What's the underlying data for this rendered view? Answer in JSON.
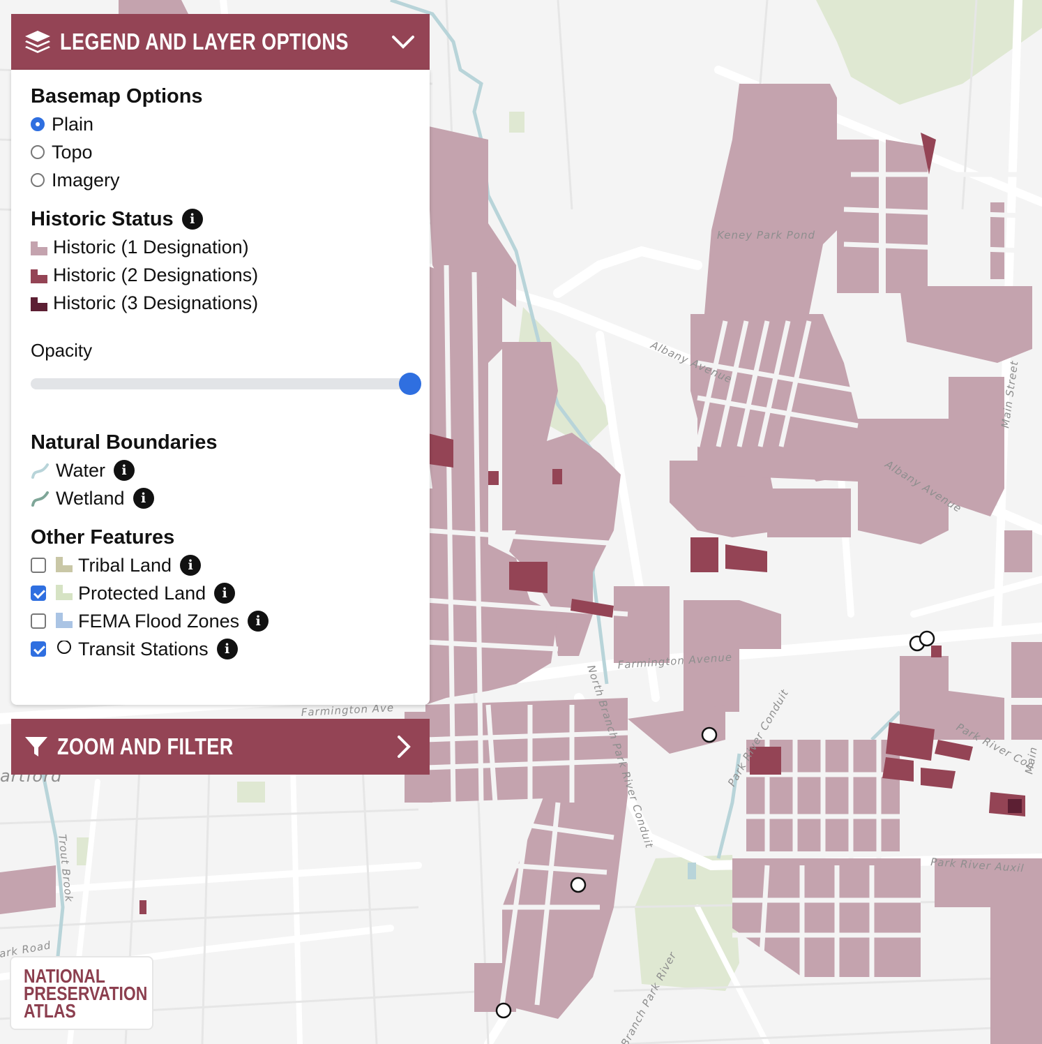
{
  "legend": {
    "header_title": "Legend and Layer Options",
    "basemap": {
      "title": "Basemap Options",
      "options": [
        {
          "label": "Plain",
          "selected": true
        },
        {
          "label": "Topo",
          "selected": false
        },
        {
          "label": "Imagery",
          "selected": false
        }
      ]
    },
    "historic": {
      "title": "Historic Status",
      "items": [
        {
          "label": "Historic (1 Designation)",
          "color": "#c4a3ae"
        },
        {
          "label": "Historic (2 Designations)",
          "color": "#944455"
        },
        {
          "label": "Historic (3 Designations)",
          "color": "#5c1f33"
        }
      ],
      "opacity_label": "Opacity",
      "opacity_value": 1.0
    },
    "natural": {
      "title": "Natural Boundaries",
      "items": [
        {
          "label": "Water",
          "color": "#b8d4d9"
        },
        {
          "label": "Wetland",
          "color": "#7fa698"
        }
      ]
    },
    "other": {
      "title": "Other Features",
      "items": [
        {
          "label": "Tribal Land",
          "checked": false,
          "color": "#c9c7a6"
        },
        {
          "label": "Protected Land",
          "checked": true,
          "color": "#d6e3c4"
        },
        {
          "label": "FEMA Flood Zones",
          "checked": false,
          "color": "#aac4e4"
        },
        {
          "label": "Transit Stations",
          "checked": true,
          "icon": "circle-outline"
        }
      ]
    }
  },
  "zoom_filter": {
    "title": "Zoom and Filter"
  },
  "map_labels": {
    "keney_park_pond": "Keney Park Pond",
    "albany_avenue_1": "Albany Avenue",
    "albany_avenue_2": "Albany Avenue",
    "main_street": "Main Street",
    "farmington_avenue_1": "Farmington Avenue",
    "farmington_avenue_2": "Farmington Ave",
    "north_branch_conduit": "North Branch Park River Conduit",
    "park_river_conduit": "Park River Conduit",
    "park_river_conduit_2": "Park River Con",
    "park_river_auxiliary": "Park River Auxil",
    "trout_brook": "Trout Brook",
    "park_road": "ark Road",
    "hartford": "artford",
    "north_branch_park_river": "North Branch Park River",
    "main_fragment": "Main"
  },
  "logo": {
    "lines": [
      "NATIONAL",
      "PRESERVATION",
      "ATLAS"
    ]
  },
  "colors": {
    "accent": "#944455",
    "historic_1": "#c4a3ae",
    "historic_2": "#944455",
    "historic_3": "#5c1f33",
    "road": "#ffffff",
    "map_bg": "#f4f4f4",
    "park": "#dfe8d2",
    "water": "#b8d4d9",
    "selected": "#2f6fe0"
  },
  "transit_stations": 6
}
